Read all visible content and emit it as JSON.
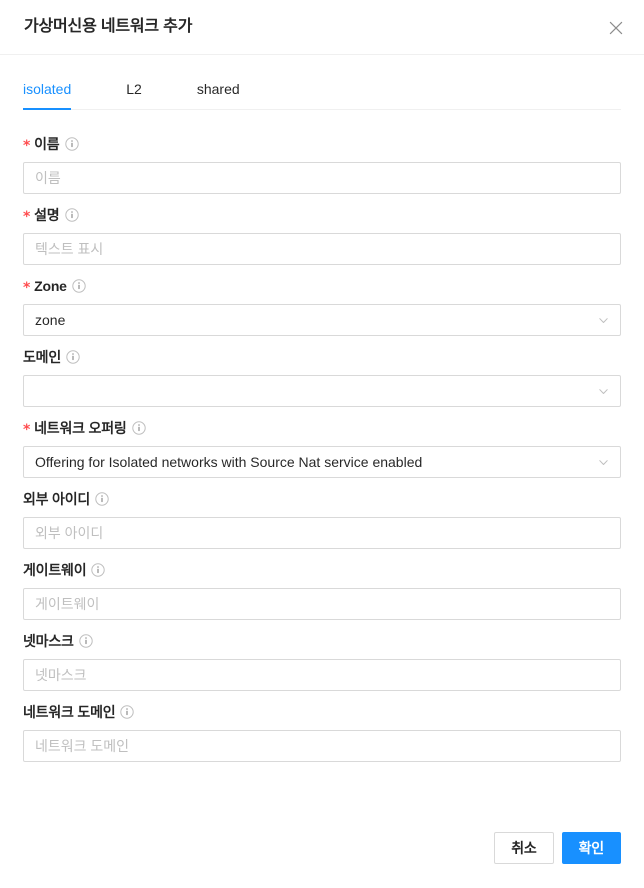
{
  "modal": {
    "title": "가상머신용 네트워크 추가",
    "close_icon": "close-icon"
  },
  "tabs": {
    "active": "isolated",
    "items": [
      {
        "key": "isolated",
        "label": "isolated"
      },
      {
        "key": "l2",
        "label": "L2"
      },
      {
        "key": "shared",
        "label": "shared"
      }
    ]
  },
  "form": {
    "fields": [
      {
        "key": "name",
        "label": "이름",
        "required": true,
        "type": "input",
        "value": "",
        "placeholder": "이름",
        "info_icon": "info-circle-icon"
      },
      {
        "key": "description",
        "label": "설명",
        "required": true,
        "type": "input",
        "value": "",
        "placeholder": "텍스트 표시",
        "info_icon": "info-circle-icon"
      },
      {
        "key": "zone",
        "label": "Zone",
        "required": true,
        "type": "select",
        "value": "zone",
        "placeholder": "",
        "info_icon": "info-circle-icon",
        "arrow_icon": "chevron-down-icon"
      },
      {
        "key": "domain",
        "label": "도메인",
        "required": false,
        "type": "select",
        "value": "",
        "placeholder": "",
        "info_icon": "info-circle-icon",
        "arrow_icon": "chevron-down-icon"
      },
      {
        "key": "network-offering",
        "label": "네트워크 오퍼링",
        "required": true,
        "type": "select",
        "value": "Offering for Isolated networks with Source Nat service enabled",
        "placeholder": "",
        "info_icon": "info-circle-icon",
        "arrow_icon": "chevron-down-icon"
      },
      {
        "key": "external-id",
        "label": "외부 아이디",
        "required": false,
        "type": "input",
        "value": "",
        "placeholder": "외부 아이디",
        "info_icon": "info-circle-icon"
      },
      {
        "key": "gateway",
        "label": "게이트웨이",
        "required": false,
        "type": "input",
        "value": "",
        "placeholder": "게이트웨이",
        "info_icon": "info-circle-icon"
      },
      {
        "key": "netmask",
        "label": "넷마스크",
        "required": false,
        "type": "input",
        "value": "",
        "placeholder": "넷마스크",
        "info_icon": "info-circle-icon"
      },
      {
        "key": "network-domain",
        "label": "네트워크 도메인",
        "required": false,
        "type": "input",
        "value": "",
        "placeholder": "네트워크 도메인",
        "info_icon": "info-circle-icon"
      }
    ]
  },
  "footer": {
    "cancel_label": "취소",
    "ok_label": "확인"
  },
  "colors": {
    "primary": "#1890ff",
    "required_star": "#ff4d4f",
    "border": "#d9d9d9",
    "divider": "#f0f0f0",
    "placeholder": "#bfbfbf",
    "text": "rgba(0,0,0,0.85)"
  }
}
